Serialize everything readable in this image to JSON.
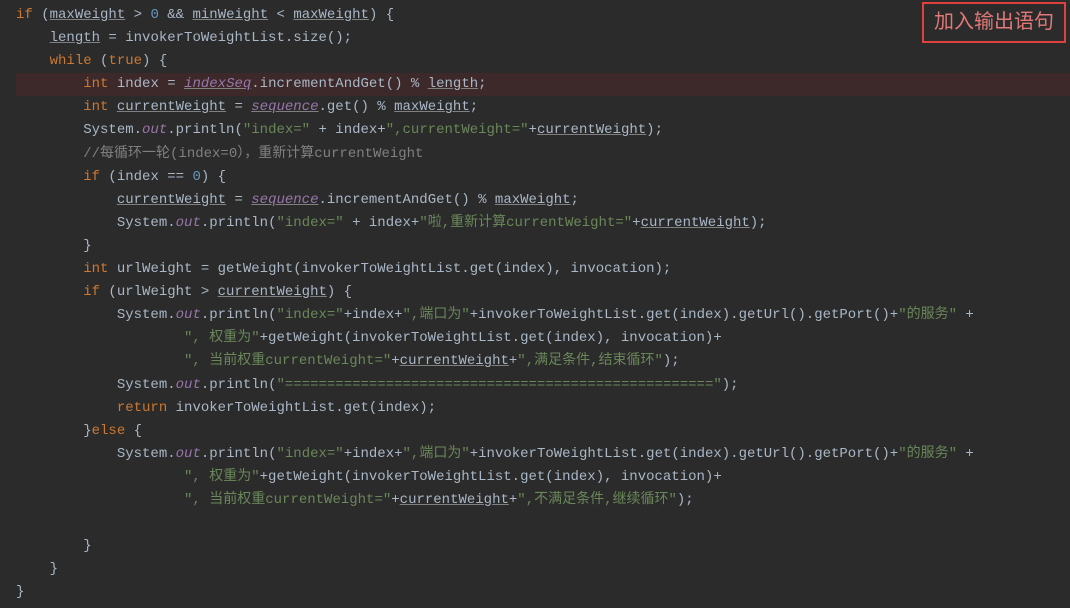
{
  "annotation": {
    "label": "加入输出语句"
  },
  "code": {
    "lines": [
      {
        "indent": 0,
        "tokens": [
          {
            "cls": "kw",
            "t": "if"
          },
          {
            "cls": "plain",
            "t": " ("
          },
          {
            "cls": "underline",
            "t": "maxWeight"
          },
          {
            "cls": "plain",
            "t": " > "
          },
          {
            "cls": "num",
            "t": "0"
          },
          {
            "cls": "plain",
            "t": " && "
          },
          {
            "cls": "underline",
            "t": "minWeight"
          },
          {
            "cls": "plain",
            "t": " < "
          },
          {
            "cls": "underline",
            "t": "maxWeight"
          },
          {
            "cls": "plain",
            "t": ") {"
          }
        ]
      },
      {
        "indent": 1,
        "tokens": [
          {
            "cls": "underline",
            "t": "length"
          },
          {
            "cls": "plain",
            "t": " = invokerToWeightList.size();"
          }
        ]
      },
      {
        "indent": 1,
        "tokens": [
          {
            "cls": "kw",
            "t": "while"
          },
          {
            "cls": "plain",
            "t": " ("
          },
          {
            "cls": "kw",
            "t": "true"
          },
          {
            "cls": "plain",
            "t": ") {"
          }
        ]
      },
      {
        "indent": 2,
        "highlight": true,
        "tokens": [
          {
            "cls": "kw",
            "t": "int"
          },
          {
            "cls": "plain",
            "t": " index = "
          },
          {
            "cls": "field underline",
            "t": "indexSeq"
          },
          {
            "cls": "plain",
            "t": ".incrementAndGet() % "
          },
          {
            "cls": "underline",
            "t": "length"
          },
          {
            "cls": "plain",
            "t": ";"
          }
        ]
      },
      {
        "indent": 2,
        "tokens": [
          {
            "cls": "kw",
            "t": "int"
          },
          {
            "cls": "plain",
            "t": " "
          },
          {
            "cls": "underline",
            "t": "currentWeight"
          },
          {
            "cls": "plain",
            "t": " = "
          },
          {
            "cls": "field underline",
            "t": "sequence"
          },
          {
            "cls": "plain",
            "t": ".get() % "
          },
          {
            "cls": "underline",
            "t": "maxWeight"
          },
          {
            "cls": "plain",
            "t": ";"
          }
        ]
      },
      {
        "indent": 2,
        "tokens": [
          {
            "cls": "plain",
            "t": "System."
          },
          {
            "cls": "field",
            "t": "out"
          },
          {
            "cls": "plain",
            "t": ".println("
          },
          {
            "cls": "str",
            "t": "\"index=\""
          },
          {
            "cls": "plain",
            "t": " + index+"
          },
          {
            "cls": "str",
            "t": "\",currentWeight=\""
          },
          {
            "cls": "plain",
            "t": "+"
          },
          {
            "cls": "underline",
            "t": "currentWeight"
          },
          {
            "cls": "plain",
            "t": ");"
          }
        ]
      },
      {
        "indent": 2,
        "tokens": [
          {
            "cls": "comment",
            "t": "//每循环一轮(index=0），重新计算currentWeight"
          }
        ]
      },
      {
        "indent": 2,
        "tokens": [
          {
            "cls": "kw",
            "t": "if"
          },
          {
            "cls": "plain",
            "t": " (index == "
          },
          {
            "cls": "num",
            "t": "0"
          },
          {
            "cls": "plain",
            "t": ") {"
          }
        ]
      },
      {
        "indent": 3,
        "tokens": [
          {
            "cls": "underline",
            "t": "currentWeight"
          },
          {
            "cls": "plain",
            "t": " = "
          },
          {
            "cls": "field underline",
            "t": "sequence"
          },
          {
            "cls": "plain",
            "t": ".incrementAndGet() % "
          },
          {
            "cls": "underline",
            "t": "maxWeight"
          },
          {
            "cls": "plain",
            "t": ";"
          }
        ]
      },
      {
        "indent": 3,
        "tokens": [
          {
            "cls": "plain",
            "t": "System."
          },
          {
            "cls": "field",
            "t": "out"
          },
          {
            "cls": "plain",
            "t": ".println("
          },
          {
            "cls": "str",
            "t": "\"index=\""
          },
          {
            "cls": "plain",
            "t": " + index+"
          },
          {
            "cls": "str",
            "t": "\"啦,重新计算currentWeight=\""
          },
          {
            "cls": "plain",
            "t": "+"
          },
          {
            "cls": "underline",
            "t": "currentWeight"
          },
          {
            "cls": "plain",
            "t": ");"
          }
        ]
      },
      {
        "indent": 2,
        "tokens": [
          {
            "cls": "plain",
            "t": "}"
          }
        ]
      },
      {
        "indent": 2,
        "tokens": [
          {
            "cls": "kw",
            "t": "int"
          },
          {
            "cls": "plain",
            "t": " urlWeight = getWeight(invokerToWeightList.get(index), invocation);"
          }
        ]
      },
      {
        "indent": 2,
        "tokens": [
          {
            "cls": "kw",
            "t": "if"
          },
          {
            "cls": "plain",
            "t": " (urlWeight > "
          },
          {
            "cls": "underline",
            "t": "currentWeight"
          },
          {
            "cls": "plain",
            "t": ") {"
          }
        ]
      },
      {
        "indent": 3,
        "tokens": [
          {
            "cls": "plain",
            "t": "System."
          },
          {
            "cls": "field",
            "t": "out"
          },
          {
            "cls": "plain",
            "t": ".println("
          },
          {
            "cls": "str",
            "t": "\"index=\""
          },
          {
            "cls": "plain",
            "t": "+index+"
          },
          {
            "cls": "str",
            "t": "\",端口为\""
          },
          {
            "cls": "plain",
            "t": "+invokerToWeightList.get(index).getUrl().getPort()+"
          },
          {
            "cls": "str",
            "t": "\"的服务\""
          },
          {
            "cls": "plain",
            "t": " +"
          }
        ]
      },
      {
        "indent": 5,
        "tokens": [
          {
            "cls": "str",
            "t": "\", 权重为\""
          },
          {
            "cls": "plain",
            "t": "+getWeight(invokerToWeightList.get(index), invocation)+"
          }
        ]
      },
      {
        "indent": 5,
        "tokens": [
          {
            "cls": "str",
            "t": "\", 当前权重currentWeight=\""
          },
          {
            "cls": "plain",
            "t": "+"
          },
          {
            "cls": "underline",
            "t": "currentWeight"
          },
          {
            "cls": "plain",
            "t": "+"
          },
          {
            "cls": "str",
            "t": "\",满足条件,结束循环\""
          },
          {
            "cls": "plain",
            "t": ");"
          }
        ]
      },
      {
        "indent": 3,
        "tokens": [
          {
            "cls": "plain",
            "t": "System."
          },
          {
            "cls": "field",
            "t": "out"
          },
          {
            "cls": "plain",
            "t": ".println("
          },
          {
            "cls": "str",
            "t": "\"===================================================\""
          },
          {
            "cls": "plain",
            "t": ");"
          }
        ]
      },
      {
        "indent": 3,
        "tokens": [
          {
            "cls": "kw",
            "t": "return"
          },
          {
            "cls": "plain",
            "t": " invokerToWeightList.get(index);"
          }
        ]
      },
      {
        "indent": 2,
        "tokens": [
          {
            "cls": "plain",
            "t": "}"
          },
          {
            "cls": "kw",
            "t": "else "
          },
          {
            "cls": "plain",
            "t": "{"
          }
        ]
      },
      {
        "indent": 3,
        "tokens": [
          {
            "cls": "plain",
            "t": "System."
          },
          {
            "cls": "field",
            "t": "out"
          },
          {
            "cls": "plain",
            "t": ".println("
          },
          {
            "cls": "str",
            "t": "\"index=\""
          },
          {
            "cls": "plain",
            "t": "+index+"
          },
          {
            "cls": "str",
            "t": "\",端口为\""
          },
          {
            "cls": "plain",
            "t": "+invokerToWeightList.get(index).getUrl().getPort()+"
          },
          {
            "cls": "str",
            "t": "\"的服务\""
          },
          {
            "cls": "plain",
            "t": " +"
          }
        ]
      },
      {
        "indent": 5,
        "tokens": [
          {
            "cls": "str",
            "t": "\", 权重为\""
          },
          {
            "cls": "plain",
            "t": "+getWeight(invokerToWeightList.get(index), invocation)+"
          }
        ]
      },
      {
        "indent": 5,
        "tokens": [
          {
            "cls": "str",
            "t": "\", 当前权重currentWeight=\""
          },
          {
            "cls": "plain",
            "t": "+"
          },
          {
            "cls": "underline",
            "t": "currentWeight"
          },
          {
            "cls": "plain",
            "t": "+"
          },
          {
            "cls": "str",
            "t": "\",不满足条件,继续循环\""
          },
          {
            "cls": "plain",
            "t": ");"
          }
        ]
      },
      {
        "indent": 3,
        "tokens": []
      },
      {
        "indent": 2,
        "tokens": [
          {
            "cls": "plain",
            "t": "}"
          }
        ]
      },
      {
        "indent": 1,
        "tokens": [
          {
            "cls": "plain",
            "t": "}"
          }
        ]
      },
      {
        "indent": 0,
        "tokens": [
          {
            "cls": "plain",
            "t": "}"
          }
        ]
      }
    ]
  }
}
